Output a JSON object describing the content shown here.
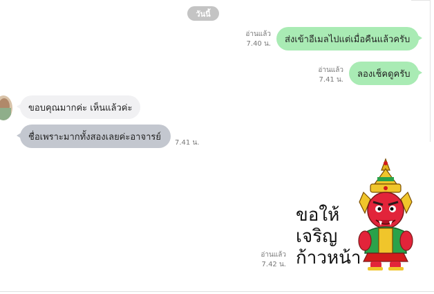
{
  "date_separator": "วันนี้",
  "messages": [
    {
      "direction": "out",
      "text": "ส่งเข้าอีเมลไปแต่เมื่อคืนแล้วครับ",
      "read": "อ่านแล้ว",
      "time": "7.40 น."
    },
    {
      "direction": "out",
      "text": "ลองเช็คดูครับ",
      "read": "อ่านแล้ว",
      "time": "7.41 น."
    },
    {
      "direction": "in",
      "text": "ขอบคุณมากค่ะ เห็นแล้วค่ะ"
    },
    {
      "direction": "in",
      "text": "ชื่อเพราะมากทั้งสองเลยค่ะอาจารย์",
      "time": "7.41 น.",
      "selected": true
    },
    {
      "direction": "out",
      "type": "sticker",
      "sticker_text": "ขอให้\nเจริญ\nก้าวหน้า",
      "sticker_lines": [
        "ขอให้",
        "เจริญ",
        "ก้าวหน้า"
      ],
      "read": "อ่านแล้ว",
      "time": "7.42 น."
    }
  ],
  "colors": {
    "outgoing_bubble": "#a9ebb4",
    "incoming_bubble": "#f1f1f3",
    "selected_bubble": "#c3c7cf",
    "date_chip": "#c4c4c4"
  },
  "icons": [
    "avatar",
    "sticker-red-giant"
  ]
}
